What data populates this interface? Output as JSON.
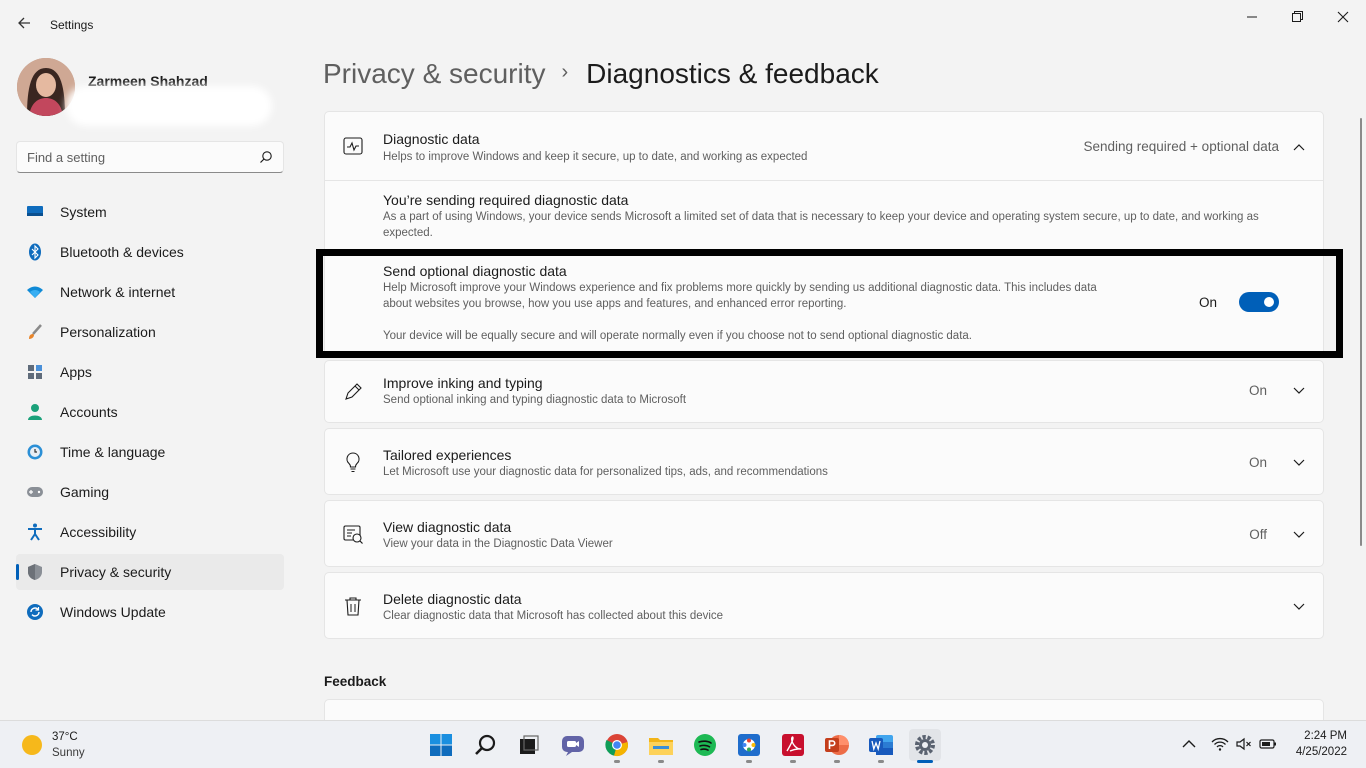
{
  "window": {
    "title": "Settings"
  },
  "profile": {
    "name": "Zarmeen Shahzad"
  },
  "search": {
    "placeholder": "Find a setting"
  },
  "sidebar": {
    "items": [
      {
        "label": "System",
        "icon": "system-icon"
      },
      {
        "label": "Bluetooth & devices",
        "icon": "bluetooth-icon"
      },
      {
        "label": "Network & internet",
        "icon": "wifi-icon"
      },
      {
        "label": "Personalization",
        "icon": "brush-icon"
      },
      {
        "label": "Apps",
        "icon": "apps-icon"
      },
      {
        "label": "Accounts",
        "icon": "person-icon"
      },
      {
        "label": "Time & language",
        "icon": "clock-globe-icon"
      },
      {
        "label": "Gaming",
        "icon": "gamepad-icon"
      },
      {
        "label": "Accessibility",
        "icon": "accessibility-icon"
      },
      {
        "label": "Privacy & security",
        "icon": "shield-icon",
        "active": true
      },
      {
        "label": "Windows Update",
        "icon": "update-icon"
      }
    ]
  },
  "breadcrumb": {
    "parent": "Privacy & security",
    "separator": "›",
    "current": "Diagnostics & feedback"
  },
  "diagnostic_data": {
    "title": "Diagnostic data",
    "description": "Helps to improve Windows and keep it secure, up to date, and working as expected",
    "status": "Sending required + optional data",
    "required": {
      "title": "You’re sending required diagnostic data",
      "description": "As a part of using Windows, your device sends Microsoft a limited set of data that is necessary to keep your device and operating system secure, up to date, and working as expected."
    },
    "optional": {
      "title": "Send optional diagnostic data",
      "description": "Help Microsoft improve your Windows experience and fix problems more quickly by sending us additional diagnostic data. This includes data about websites you browse, how you use apps and features, and enhanced error reporting.",
      "note": "Your device will be equally secure and will operate normally even if you choose not to send optional diagnostic data.",
      "toggle_label": "On",
      "toggle_on": true
    }
  },
  "settings_rows": [
    {
      "title": "Improve inking and typing",
      "description": "Send optional inking and typing diagnostic data to Microsoft",
      "status": "On",
      "icon": "pen-icon"
    },
    {
      "title": "Tailored experiences",
      "description": "Let Microsoft use your diagnostic data for personalized tips, ads, and recommendations",
      "status": "On",
      "icon": "lightbulb-icon"
    },
    {
      "title": "View diagnostic data",
      "description": "View your data in the Diagnostic Data Viewer",
      "status": "Off",
      "icon": "data-viewer-icon"
    },
    {
      "title": "Delete diagnostic data",
      "description": "Clear diagnostic data that Microsoft has collected about this device",
      "status": "",
      "icon": "trash-icon"
    }
  ],
  "feedback_section": {
    "label": "Feedback"
  },
  "taskbar": {
    "weather_temp": "37°C",
    "weather_condition": "Sunny",
    "apps": [
      "start-icon",
      "search-icon",
      "task-view-icon",
      "chat-icon",
      "chrome-icon",
      "file-explorer-icon",
      "spotify-icon",
      "photos-icon",
      "acrobat-icon",
      "powerpoint-icon",
      "word-icon",
      "settings-icon"
    ],
    "time": "2:24 PM",
    "date": "4/25/2022"
  },
  "colors": {
    "accent": "#005fb8",
    "background": "#f3f3f3",
    "card": "#fbfbfb"
  }
}
